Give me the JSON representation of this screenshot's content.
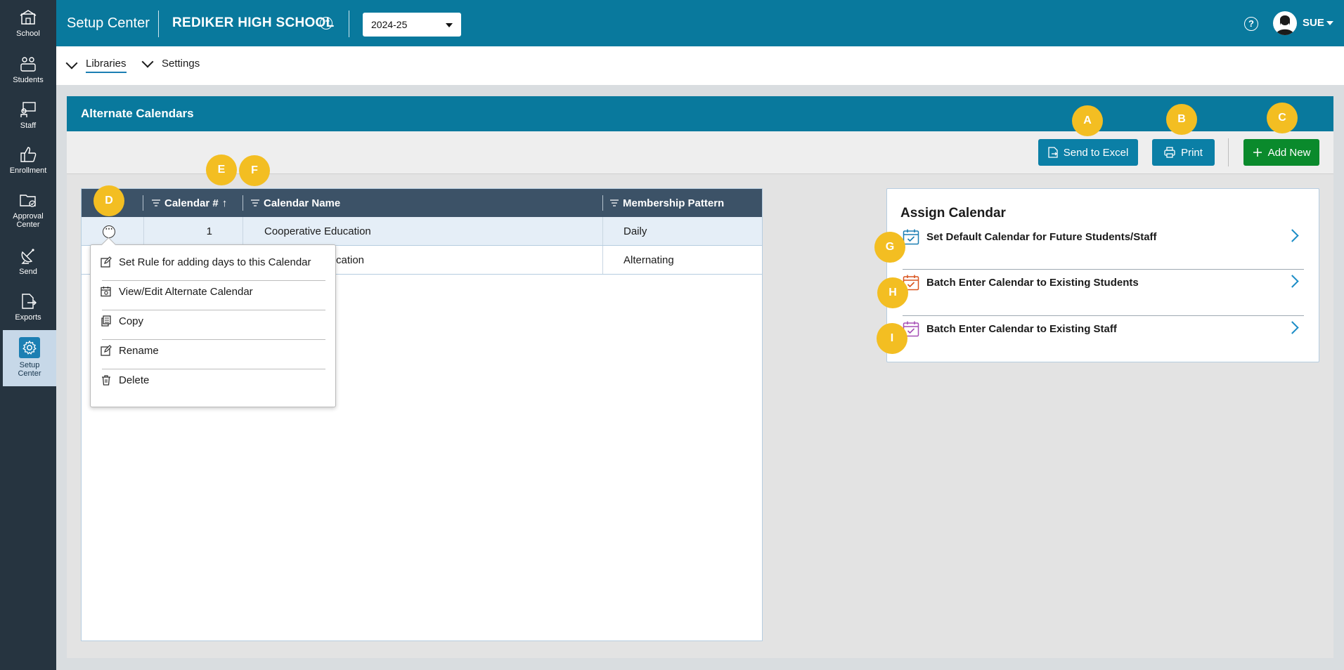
{
  "sidebar": {
    "items": [
      {
        "label": "School",
        "icon": "school-icon"
      },
      {
        "label": "Students",
        "icon": "students-icon"
      },
      {
        "label": "Staff",
        "icon": "staff-icon"
      },
      {
        "label": "Enrollment",
        "icon": "thumbs-up-icon"
      },
      {
        "label_line1": "Approval",
        "label_line2": "Center",
        "icon": "approval-folder-icon"
      },
      {
        "label": "Send",
        "icon": "satellite-dish-icon"
      },
      {
        "label": "Exports",
        "icon": "export-file-icon"
      },
      {
        "label_line1": "Setup",
        "label_line2": "Center",
        "icon": "gear-icon",
        "active": true
      }
    ]
  },
  "topbar": {
    "title": "Setup Center",
    "school": "REDIKER HIGH SCHOOL",
    "school_more": "⋯",
    "year": "2024-25",
    "help": "?",
    "user": "SUE"
  },
  "subnav": {
    "libraries": "Libraries",
    "settings": "Settings"
  },
  "panel": {
    "title": "Alternate Calendars"
  },
  "toolbar": {
    "send_to_excel": "Send to Excel",
    "print": "Print",
    "add_new": "Add New"
  },
  "grid": {
    "headers": {
      "calendar_num": "Calendar #",
      "sort_indicator": "↑",
      "calendar_name": "Calendar Name",
      "membership_pattern": "Membership Pattern"
    },
    "rows": [
      {
        "num": "1",
        "name": "Cooperative Education",
        "pattern": "Daily"
      },
      {
        "num": "",
        "name": "cation",
        "pattern": "Alternating"
      }
    ]
  },
  "context_menu": {
    "items": [
      "Set Rule for adding days to this Calendar",
      "View/Edit Alternate Calendar",
      "Copy",
      "Rename",
      "Delete"
    ]
  },
  "assign": {
    "title": "Assign Calendar",
    "items": [
      {
        "label": "Set Default Calendar for Future Students/Staff",
        "color": "#1c7fb3"
      },
      {
        "label": "Batch Enter Calendar to Existing Students",
        "color": "#d9541e"
      },
      {
        "label": "Batch Enter Calendar to Existing Staff",
        "color": "#a54fb5"
      }
    ]
  },
  "badges": {
    "a": "A",
    "b": "B",
    "c": "C",
    "d": "D",
    "e": "E",
    "f": "F",
    "g": "G",
    "h": "H",
    "i": "I"
  },
  "colors": {
    "topbar": "#09799d",
    "sidebar": "#263440",
    "header_row": "#3c5267",
    "badge": "#f3be22",
    "add_button": "#0a8a2c"
  }
}
